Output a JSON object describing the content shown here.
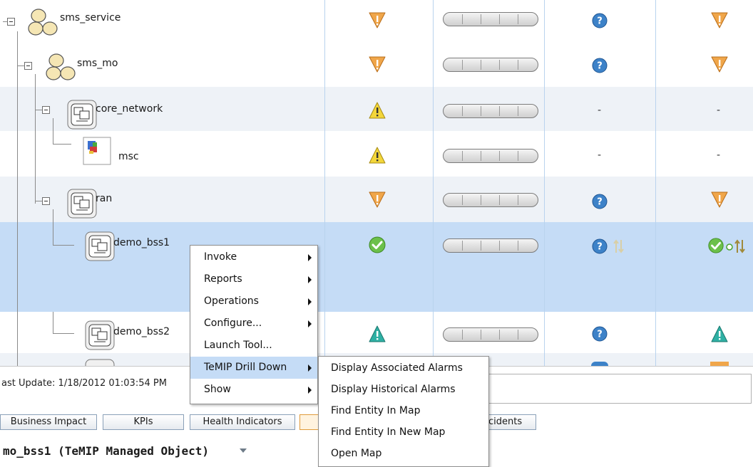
{
  "tree": {
    "nodes": [
      {
        "label": "sms_service",
        "icon": "group-icon"
      },
      {
        "label": "sms_mo",
        "icon": "group-icon"
      },
      {
        "label": "core_network",
        "icon": "managed-object-icon"
      },
      {
        "label": "msc",
        "icon": "device-icon"
      },
      {
        "label": "ran",
        "icon": "managed-object-icon"
      },
      {
        "label": "demo_bss1",
        "icon": "managed-object-icon"
      },
      {
        "label": "demo_bss2",
        "icon": "managed-object-icon"
      }
    ],
    "placeholder": "-"
  },
  "context_menu": {
    "items": [
      {
        "label": "Invoke",
        "has_submenu": true
      },
      {
        "label": "Reports",
        "has_submenu": true
      },
      {
        "label": "Operations",
        "has_submenu": true
      },
      {
        "label": "Configure...",
        "has_submenu": true
      },
      {
        "label": "Launch Tool...",
        "has_submenu": false
      },
      {
        "label": "TeMIP Drill Down",
        "has_submenu": true,
        "highlighted": true
      },
      {
        "label": "Show",
        "has_submenu": true
      }
    ]
  },
  "submenu": {
    "items": [
      {
        "label": "Display Associated Alarms"
      },
      {
        "label": "Display Historical Alarms"
      },
      {
        "label": "Find Entity In Map"
      },
      {
        "label": "Find Entity In New Map"
      },
      {
        "label": "Open Map"
      }
    ]
  },
  "status": {
    "last_update": "ast Update: 1/18/2012 01:03:54 PM"
  },
  "tabs": [
    {
      "label": "Business Impact"
    },
    {
      "label": "KPIs"
    },
    {
      "label": "Health Indicators"
    },
    {
      "label": "cidents"
    }
  ],
  "details": {
    "title": "mo_bss1 (TeMIP Managed Object)"
  },
  "colors": {
    "selected_row": "#c5dcf6",
    "alt_row": "#eef2f7",
    "warning_orange": "#f0a64a",
    "warning_yellow": "#f3d63a",
    "ok_green": "#6cc04a",
    "info_blue": "#3d82c8",
    "teal_warning": "#2fb0a4"
  }
}
